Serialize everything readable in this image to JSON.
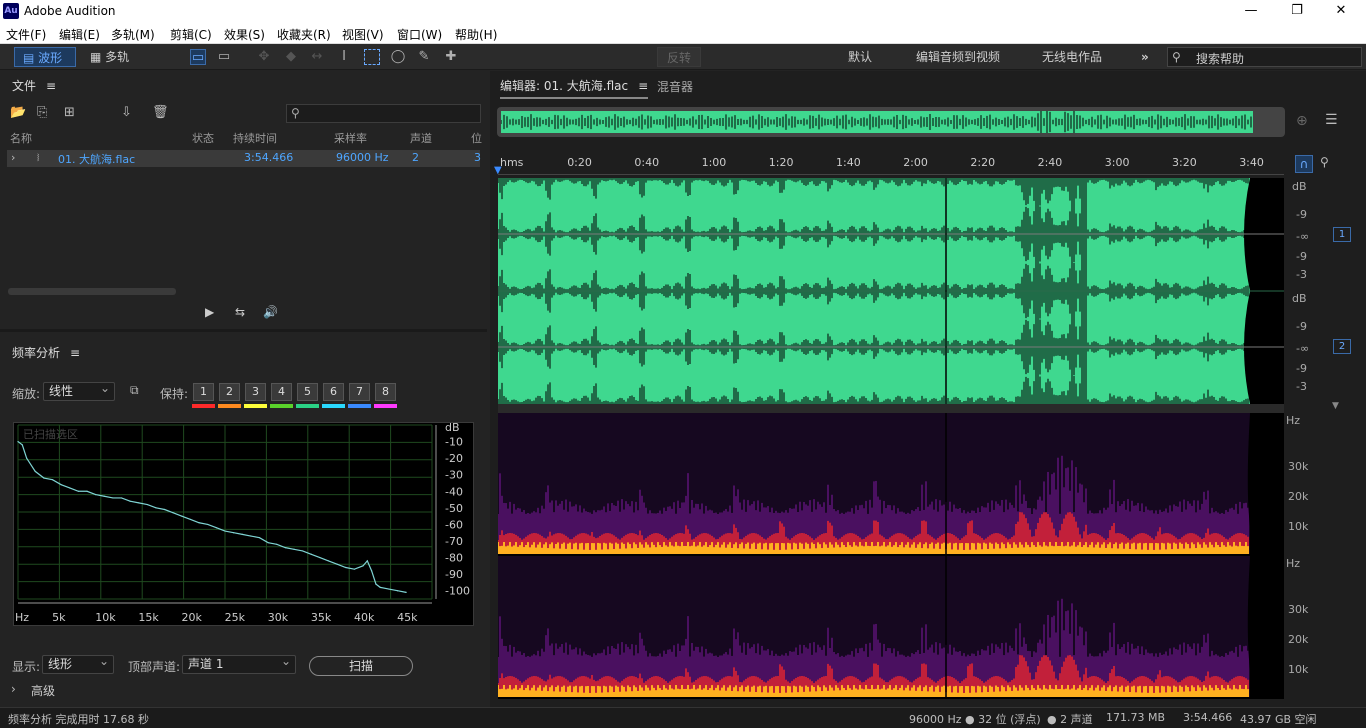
{
  "app": {
    "title": "Adobe Audition",
    "logo": "Au"
  },
  "window_controls": {
    "minimize": "—",
    "maximize": "❐",
    "close": "✕"
  },
  "menu": [
    "文件(F)",
    "编辑(E)",
    "多轨(M)",
    "剪辑(C)",
    "效果(S)",
    "收藏夹(R)",
    "视图(V)",
    "窗口(W)",
    "帮助(H)"
  ],
  "toolbar": {
    "waveform": "波形",
    "multitrack": "多轨",
    "reverse": "反转",
    "workspaces": [
      "默认",
      "编辑音频到视频",
      "无线电作品"
    ],
    "more": "»",
    "search_placeholder": "搜索帮助"
  },
  "files_panel": {
    "title": "文件",
    "columns": [
      "名称",
      "状态",
      "持续时间",
      "采样率",
      "声道",
      "位"
    ],
    "rows": [
      {
        "name": "01. 大航海.flac",
        "status": "",
        "duration": "3:54.466",
        "rate": "96000 Hz",
        "channels": "2",
        "bits": "3"
      }
    ]
  },
  "freq_panel": {
    "title": "频率分析",
    "zoom_label": "缩放:",
    "zoom_value": "线性",
    "hold_label": "保持:",
    "hold_buttons": [
      "1",
      "2",
      "3",
      "4",
      "5",
      "6",
      "7",
      "8"
    ],
    "hold_colors": [
      "#ff2a2a",
      "#ff8a1f",
      "#ffff3a",
      "#5ad22a",
      "#2ad285",
      "#2ad9ff",
      "#3a8aff",
      "#ff3aff"
    ],
    "graph_label": "已扫描选区",
    "db_unit": "dB",
    "db_ticks": [
      "-10",
      "-20",
      "-30",
      "-40",
      "-50",
      "-60",
      "-70",
      "-80",
      "-90",
      "-100"
    ],
    "hz_ticks": [
      "Hz",
      "5k",
      "10k",
      "15k",
      "20k",
      "25k",
      "30k",
      "35k",
      "40k",
      "45k"
    ],
    "display_label": "显示:",
    "display_value": "线形",
    "top_channel_label": "顶部声道:",
    "top_channel_value": "声道 1",
    "scan_button": "扫描",
    "advanced": "高级"
  },
  "editor": {
    "tab_editor": "编辑器: 01. 大航海.flac",
    "tab_mixer": "混音器",
    "ruler": [
      "hms",
      "0:20",
      "0:40",
      "1:00",
      "1:20",
      "1:40",
      "2:00",
      "2:20",
      "2:40",
      "3:00",
      "3:20",
      "3:40"
    ],
    "db_ch1": [
      "dB",
      "-9",
      "-∞",
      "-9",
      "-3"
    ],
    "db_ch2": [
      "dB",
      "-9",
      "-∞",
      "-9",
      "-3"
    ],
    "channel_1": "1",
    "channel_2": "2",
    "spec_ch1": [
      "Hz",
      "30k",
      "20k",
      "10k"
    ],
    "spec_ch2": [
      "Hz",
      "30k",
      "20k",
      "10k"
    ]
  },
  "chart_data": {
    "type": "line",
    "title": "",
    "xlabel": "Hz",
    "ylabel": "dB",
    "xlim": [
      0,
      48000
    ],
    "ylim": [
      -105,
      0
    ],
    "series": [
      {
        "values_x": [
          0,
          500,
          1000,
          2000,
          3000,
          4000,
          5000,
          6000,
          7000,
          8000,
          9000,
          10000,
          11000,
          12000,
          13000,
          14000,
          15000,
          16000,
          17000,
          18000,
          19000,
          20000,
          21000,
          22000,
          23000,
          24000,
          25000,
          26000,
          27000,
          28000,
          29000,
          30000,
          31000,
          32000,
          33000,
          34000,
          35000,
          36000,
          37000,
          38000,
          39000,
          40000,
          40500,
          41000,
          41500,
          42000,
          43000,
          44000,
          45000
        ],
        "values_y": [
          -10,
          -12,
          -20,
          -28,
          -32,
          -33,
          -36,
          -38,
          -40,
          -40,
          -42,
          -43,
          -44,
          -44,
          -46,
          -47,
          -48,
          -50,
          -51,
          -53,
          -55,
          -57,
          -59,
          -60,
          -62,
          -64,
          -65,
          -66,
          -67,
          -68,
          -71,
          -72,
          -74,
          -75,
          -76,
          -78,
          -80,
          -82,
          -84,
          -86,
          -87,
          -85,
          -82,
          -88,
          -96,
          -98,
          -99,
          -100,
          -101
        ]
      }
    ]
  },
  "status": {
    "left": "频率分析 完成用时 17.68 秒",
    "rate": "96000 Hz ● 32 位 (浮点)",
    "channels": "● 2 声道",
    "size": "171.73 MB",
    "duration": "3:54.466",
    "free": "43.97 GB 空闲"
  }
}
